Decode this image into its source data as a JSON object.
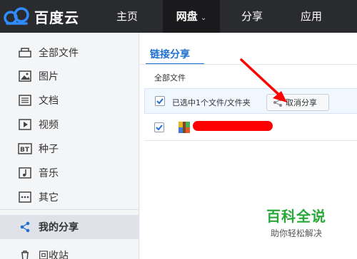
{
  "app": {
    "logo_text": "百度云"
  },
  "nav": {
    "home": "主页",
    "disk": "网盘",
    "share": "分享",
    "apps": "应用"
  },
  "sidebar": {
    "items": [
      {
        "label": "全部文件",
        "icon": "folder-icon"
      },
      {
        "label": "图片",
        "icon": "image-icon"
      },
      {
        "label": "文档",
        "icon": "document-icon"
      },
      {
        "label": "视频",
        "icon": "video-icon"
      },
      {
        "label": "种子",
        "icon": "bt-icon"
      },
      {
        "label": "音乐",
        "icon": "music-icon"
      },
      {
        "label": "其它",
        "icon": "more-icon"
      },
      {
        "label": "我的分享",
        "icon": "share-icon",
        "active": true
      },
      {
        "label": "回收站",
        "icon": "trash-icon"
      }
    ]
  },
  "main": {
    "tab_label": "链接分享",
    "breadcrumb": "全部文件",
    "selection_text": "已选中1个文件/文件夹",
    "cancel_share_label": "取消分享"
  },
  "watermark": {
    "title": "百科全说",
    "subtitle": "助你轻松解决"
  },
  "colors": {
    "accent": "#1e6fd1",
    "topbar": "#2a2b2f",
    "annotation": "#ff0000",
    "watermark": "#29a838"
  }
}
